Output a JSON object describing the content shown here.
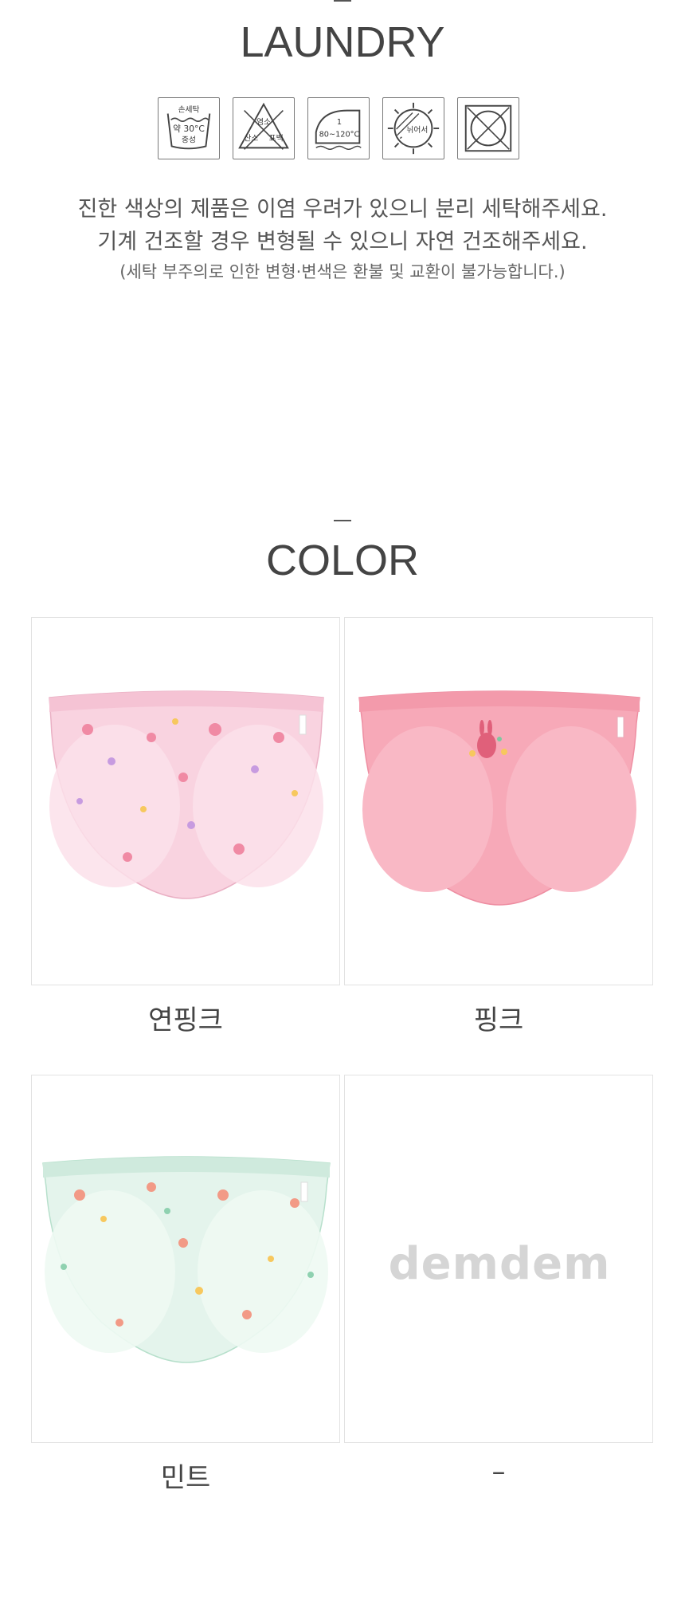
{
  "laundry": {
    "title": "LAUNDRY",
    "icons": [
      {
        "name": "hand-wash-icon",
        "lines": [
          "손세탁",
          "약 30°C",
          "중성"
        ]
      },
      {
        "name": "no-bleach-icon",
        "lines": [
          "염소",
          "산소",
          "표백"
        ]
      },
      {
        "name": "iron-temperature-icon",
        "lines": [
          "1",
          "80~120°C"
        ]
      },
      {
        "name": "shade-dry-icon",
        "lines": [
          "뉘어서"
        ]
      },
      {
        "name": "no-tumble-dry-icon",
        "lines": []
      }
    ],
    "notes": {
      "line1": "진한 색상의 제품은 이염 우려가 있으니 분리 세탁해주세요.",
      "line2": "기계 건조할 경우 변형될 수 있으니 자연 건조해주세요.",
      "line3": "(세탁 부주의로 인한 변형·변색은 환불 및 교환이 불가능합니다.)"
    }
  },
  "color": {
    "title": "COLOR",
    "items": [
      {
        "label": "연핑크",
        "fill": "#f9d3e0",
        "pattern": "floral"
      },
      {
        "label": "핑크",
        "fill": "#f7a9b8",
        "pattern": "solid"
      },
      {
        "label": "민트",
        "fill": "#e4f4ec",
        "pattern": "floral"
      },
      {
        "label": "–",
        "logo": "demdem"
      }
    ]
  }
}
